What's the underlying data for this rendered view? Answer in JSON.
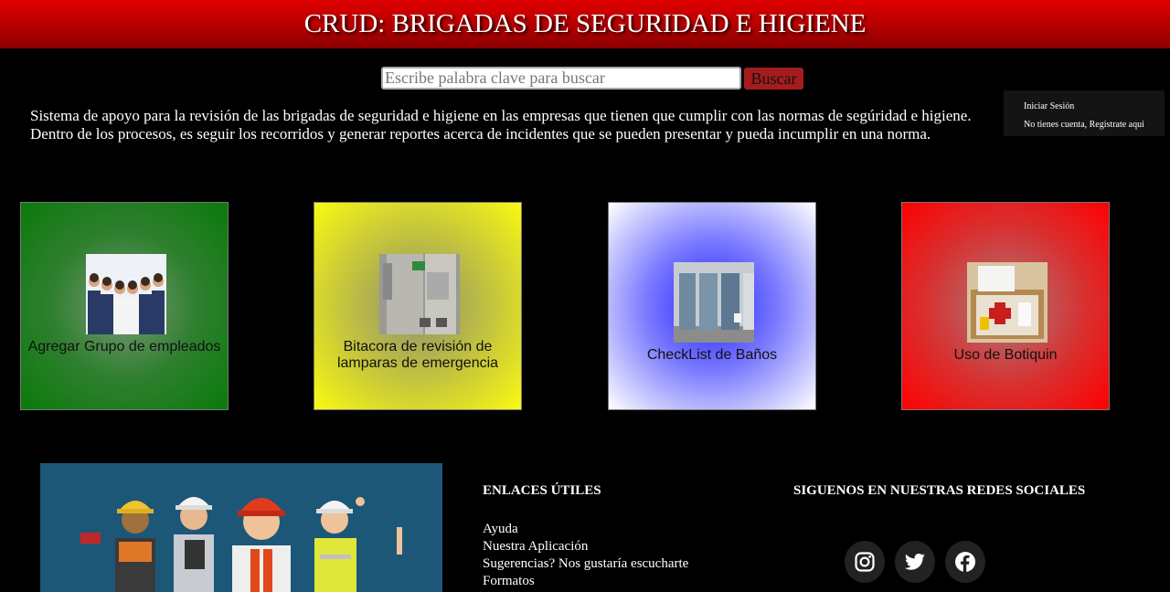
{
  "header": {
    "title": "CRUD: BRIGADAS DE SEGURIDAD E HIGIENE"
  },
  "search": {
    "placeholder": "Escribe palabra clave para buscar",
    "button_label": "Buscar"
  },
  "login": {
    "signin_label": "Iniciar Sesión",
    "register_label": "No tienes cuenta, Registrate aqui"
  },
  "intro": {
    "text": "Sistema de apoyo para la revisión de las brigadas de seguridad e higiene en las empresas que tienen que cumplir con las normas de segúridad e higiene. Dentro de los procesos, es seguir los recorridos y generar reportes acerca de incidentes que se pueden presentar y pueda incumplir en una norma."
  },
  "cards": [
    {
      "label": "Agregar Grupo de empleados",
      "image": "group-of-employees-photo"
    },
    {
      "label": "Bitacora de revisión de lamparas de emergencia",
      "image": "emergency-lamp-photo"
    },
    {
      "label": "CheckList de Baños",
      "image": "bathroom-stalls-photo"
    },
    {
      "label": "Uso de Botiquin",
      "image": "first-aid-kit-photo"
    }
  ],
  "footer": {
    "banner_image": "safety-workers-illustration",
    "links_title": "ENLACES ÚTILES",
    "links": [
      "Ayuda",
      "Nuestra Aplicación",
      "Sugerencias? Nos gustaría escucharte",
      "Formatos"
    ],
    "social_title": "SIGUENOS EN NUESTRAS REDES SOCIALES",
    "social": [
      "instagram-icon",
      "twitter-icon",
      "facebook-icon"
    ]
  }
}
